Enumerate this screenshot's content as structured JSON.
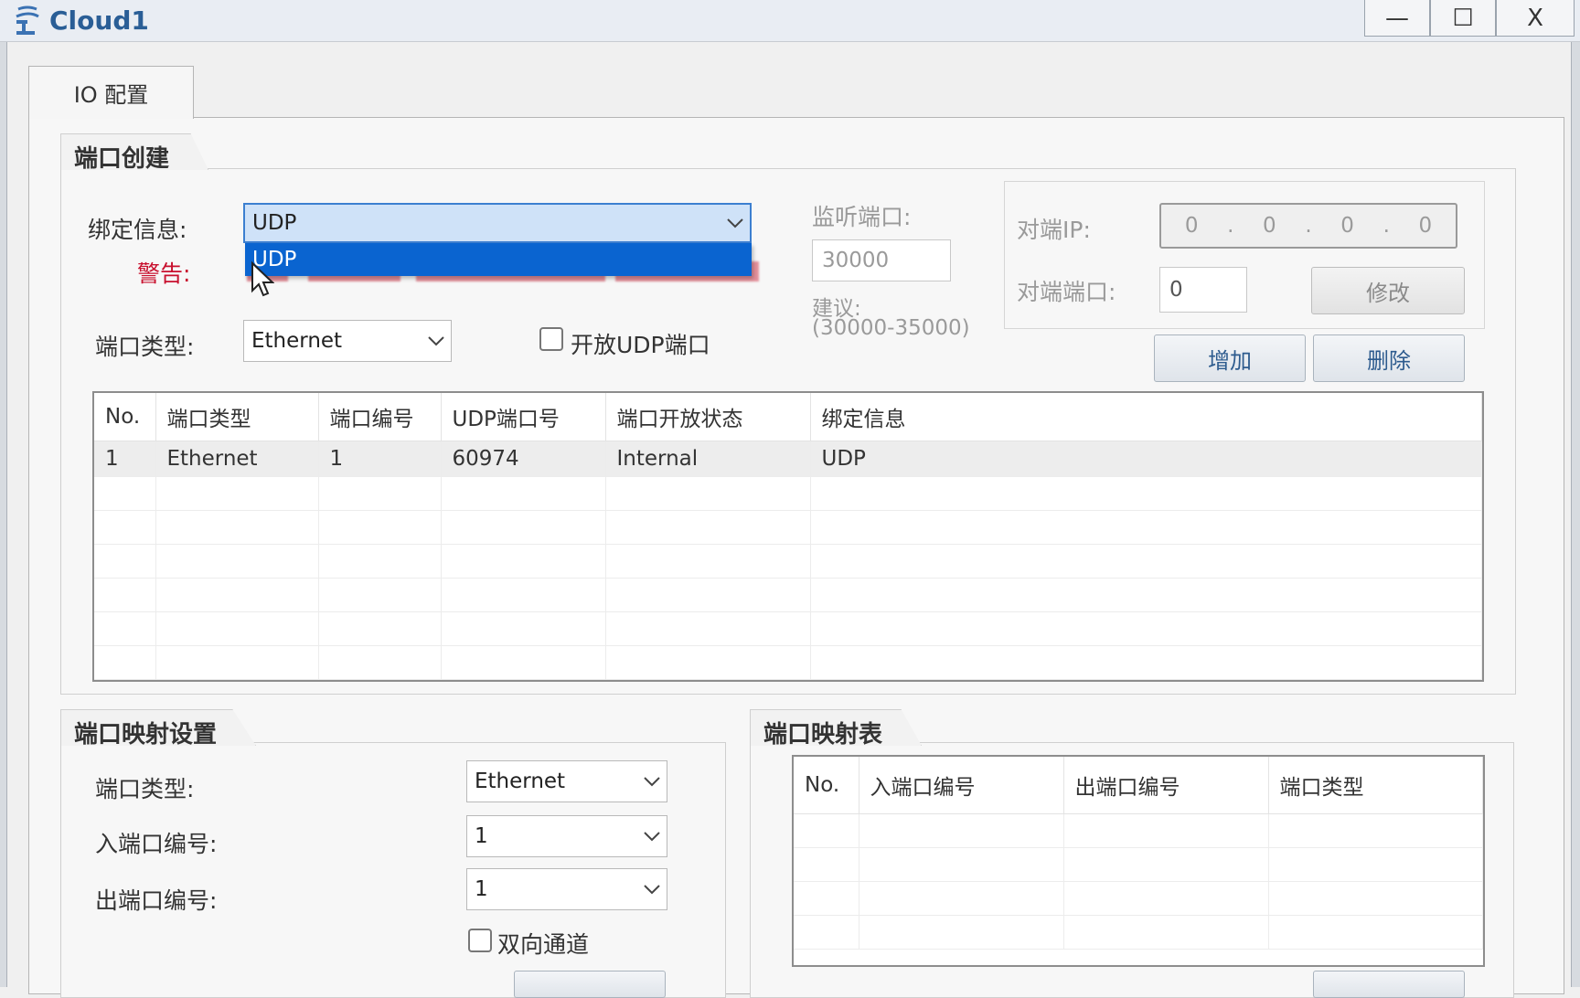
{
  "window": {
    "title": "Cloud1",
    "min": "—",
    "max": "☐",
    "close": "X"
  },
  "tab": {
    "label": "IO 配置"
  },
  "port_create": {
    "group_label": "端口创建",
    "bind_label": "绑定信息:",
    "bind_value": "UDP",
    "bind_options": [
      "UDP"
    ],
    "warning_label": "警告:",
    "port_type_label": "端口类型:",
    "port_type_value": "Ethernet",
    "open_udp_label": "开放UDP端口",
    "listen_port_label": "监听端口:",
    "listen_port_value": "30000",
    "suggest_label": "建议:",
    "suggest_range": "(30000-35000)",
    "peer_ip_label": "对端IP:",
    "peer_ip_octets": [
      "0",
      "0",
      "0",
      "0"
    ],
    "peer_port_label": "对端端口:",
    "peer_port_value": "0",
    "modify_button": "修改",
    "add_button": "增加",
    "delete_button": "删除",
    "table": {
      "headers": [
        "No.",
        "端口类型",
        "端口编号",
        "UDP端口号",
        "端口开放状态",
        "绑定信息"
      ],
      "rows": [
        [
          "1",
          "Ethernet",
          "1",
          "60974",
          "Internal",
          "UDP"
        ]
      ]
    }
  },
  "port_mapping": {
    "group_label": "端口映射设置",
    "port_type_label": "端口类型:",
    "port_type_value": "Ethernet",
    "in_port_label": "入端口编号:",
    "in_port_value": "1",
    "out_port_label": "出端口编号:",
    "out_port_value": "1",
    "bidirectional_label": "双向通道"
  },
  "mapping_table": {
    "group_label": "端口映射表",
    "headers": [
      "No.",
      "入端口编号",
      "出端口编号",
      "端口类型"
    ]
  },
  "colors": {
    "accent": "#2a5e96",
    "selection": "#0a64d0",
    "warning": "#c8102e"
  }
}
